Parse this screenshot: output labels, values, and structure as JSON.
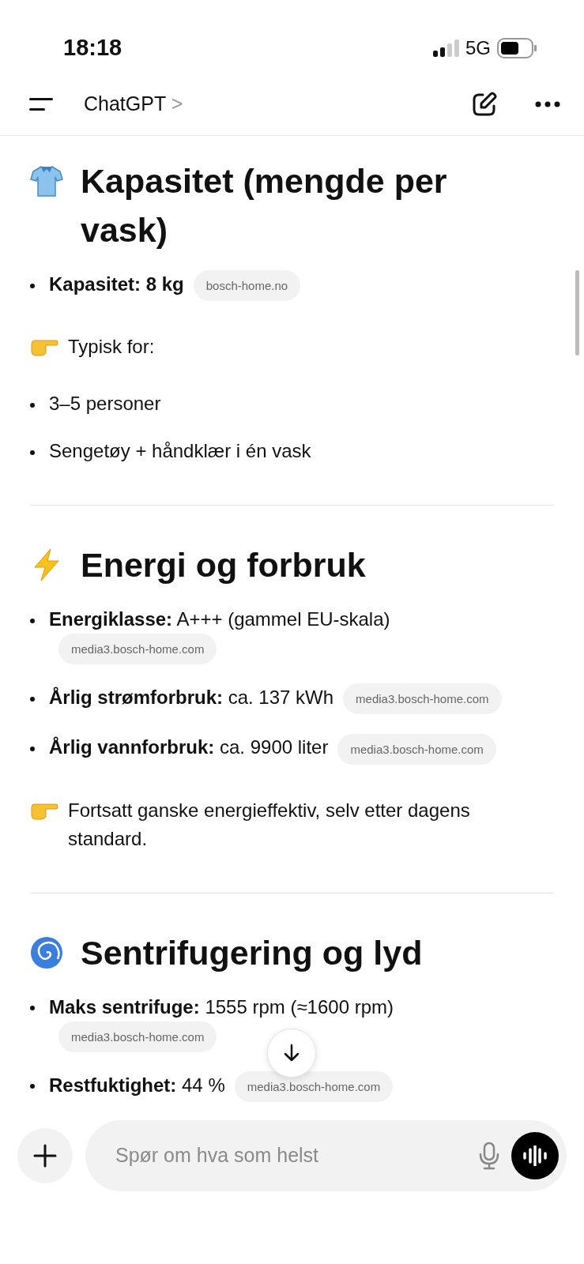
{
  "status_bar": {
    "time": "18:18",
    "network": "5G"
  },
  "nav": {
    "title": "ChatGPT",
    "chevron": ">"
  },
  "sections": [
    {
      "title": "Kapasitet (mengde per vask)",
      "blocks": [
        {
          "kind": "bullet",
          "label": "Kapasitet: 8 kg",
          "source": "bosch-home.no"
        },
        {
          "kind": "note",
          "text": "Typisk for:"
        },
        {
          "kind": "bullet",
          "text": "3–5 personer"
        },
        {
          "kind": "bullet",
          "text": "Sengetøy + håndklær i én vask"
        }
      ]
    },
    {
      "title": "Energi og forbruk",
      "blocks": [
        {
          "kind": "bullet",
          "label": "Energiklasse:",
          "text": "A+++ (gammel EU-skala)",
          "source": "media3.bosch-home.com"
        },
        {
          "kind": "bullet",
          "label": "Årlig strømforbruk:",
          "text": "ca. 137 kWh",
          "source": "media3.bosch-home.com"
        },
        {
          "kind": "bullet",
          "label": "Årlig vannforbruk:",
          "text": "ca. 9900 liter",
          "source": "media3.bosch-home.com"
        },
        {
          "kind": "note",
          "text": "Fortsatt ganske energieffektiv, selv etter dagens standard."
        }
      ]
    },
    {
      "title": "Sentrifugering og lyd",
      "blocks": [
        {
          "kind": "bullet",
          "label": "Maks sentrifuge:",
          "text": "1555 rpm (≈1600 rpm)",
          "source": "media3.bosch-home.com"
        },
        {
          "kind": "bullet",
          "label": "Restfuktighet:",
          "text": "44 %",
          "source": "media3.bosch-home.com"
        }
      ]
    }
  ],
  "composer": {
    "placeholder": "Spør om hva som helst"
  }
}
